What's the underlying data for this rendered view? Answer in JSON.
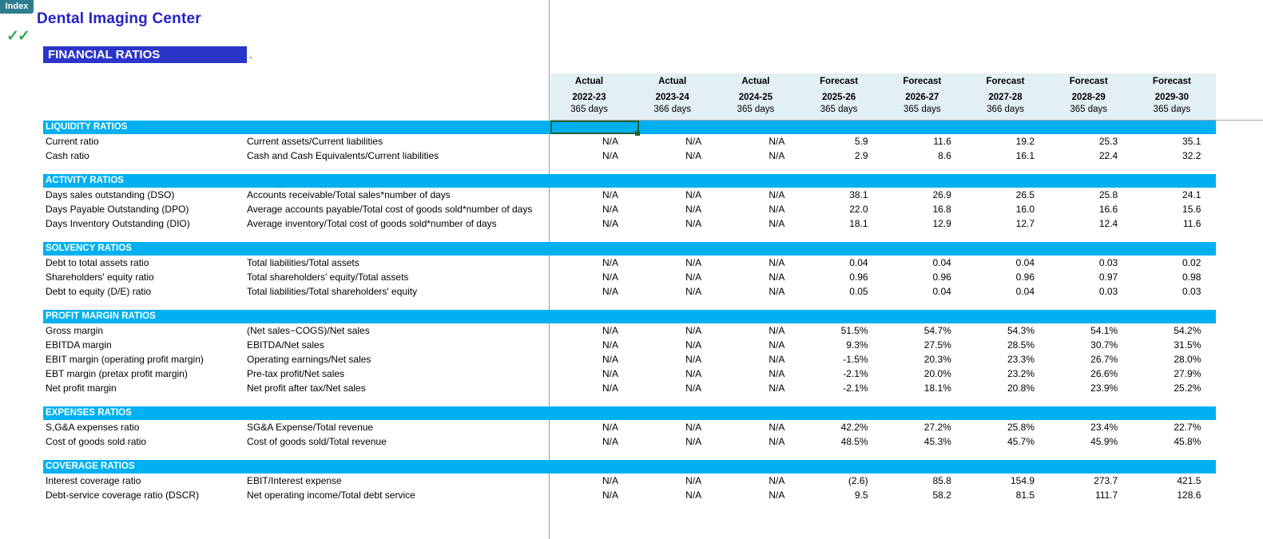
{
  "chrome": {
    "index_tab_label": "Index",
    "checkmarks": "✓✓"
  },
  "titles": {
    "company": "Dental Imaging Center",
    "banner": "FINANCIAL RATIOS",
    "banner_dot": "."
  },
  "columns": [
    {
      "type": "Actual",
      "year": "2022-23",
      "days": "365 days"
    },
    {
      "type": "Actual",
      "year": "2023-24",
      "days": "366 days"
    },
    {
      "type": "Actual",
      "year": "2024-25",
      "days": "365 days"
    },
    {
      "type": "Forecast",
      "year": "2025-26",
      "days": "365 days"
    },
    {
      "type": "Forecast",
      "year": "2026-27",
      "days": "365 days"
    },
    {
      "type": "Forecast",
      "year": "2027-28",
      "days": "366 days"
    },
    {
      "type": "Forecast",
      "year": "2028-29",
      "days": "365 days"
    },
    {
      "type": "Forecast",
      "year": "2029-30",
      "days": "365 days"
    }
  ],
  "sections": [
    {
      "title": "LIQUIDITY RATIOS",
      "rows": [
        {
          "name": "Current ratio",
          "formula": "Current assets/Current liabilities",
          "values": [
            "N/A",
            "N/A",
            "N/A",
            "5.9",
            "11.6",
            "19.2",
            "25.3",
            "35.1"
          ]
        },
        {
          "name": "Cash ratio",
          "formula": "Cash and Cash Equivalents/Current liabilities",
          "values": [
            "N/A",
            "N/A",
            "N/A",
            "2.9",
            "8.6",
            "16.1",
            "22.4",
            "32.2"
          ]
        }
      ]
    },
    {
      "title": "ACTIVITY RATIOS",
      "rows": [
        {
          "name": "Days sales outstanding (DSO)",
          "formula": "Accounts receivable/Total sales*number of days",
          "values": [
            "N/A",
            "N/A",
            "N/A",
            "38.1",
            "26.9",
            "26.5",
            "25.8",
            "24.1"
          ]
        },
        {
          "name": "Days Payable Outstanding (DPO)",
          "formula": "Average accounts payable/Total cost of goods sold*number of days",
          "values": [
            "N/A",
            "N/A",
            "N/A",
            "22.0",
            "16.8",
            "16.0",
            "16.6",
            "15.6"
          ]
        },
        {
          "name": "Days Inventory Outstanding (DIO)",
          "formula": "Average inventory/Total cost of goods sold*number of days",
          "values": [
            "N/A",
            "N/A",
            "N/A",
            "18.1",
            "12.9",
            "12.7",
            "12.4",
            "11.6"
          ]
        }
      ]
    },
    {
      "title": "SOLVENCY RATIOS",
      "rows": [
        {
          "name": "Debt to total assets ratio",
          "formula": "Total liabilities/Total assets",
          "values": [
            "N/A",
            "N/A",
            "N/A",
            "0.04",
            "0.04",
            "0.04",
            "0.03",
            "0.02"
          ]
        },
        {
          "name": "Shareholders' equity ratio",
          "formula": "Total shareholders' equity/Total assets",
          "values": [
            "N/A",
            "N/A",
            "N/A",
            "0.96",
            "0.96",
            "0.96",
            "0.97",
            "0.98"
          ]
        },
        {
          "name": "Debt to equity (D/E) ratio",
          "formula": "Total liabilities/Total shareholders' equity",
          "values": [
            "N/A",
            "N/A",
            "N/A",
            "0.05",
            "0.04",
            "0.04",
            "0.03",
            "0.03"
          ]
        }
      ]
    },
    {
      "title": "PROFIT MARGIN RATIOS",
      "rows": [
        {
          "name": "Gross margin",
          "formula": "(Net sales−COGS)/Net sales",
          "values": [
            "N/A",
            "N/A",
            "N/A",
            "51.5%",
            "54.7%",
            "54.3%",
            "54.1%",
            "54.2%"
          ]
        },
        {
          "name": "EBITDA margin",
          "formula": "EBITDA/Net sales",
          "values": [
            "N/A",
            "N/A",
            "N/A",
            "9.3%",
            "27.5%",
            "28.5%",
            "30.7%",
            "31.5%"
          ]
        },
        {
          "name": "EBIT margin (operating profit margin)",
          "formula": "Operating earnings/Net sales",
          "values": [
            "N/A",
            "N/A",
            "N/A",
            "-1.5%",
            "20.3%",
            "23.3%",
            "26.7%",
            "28.0%"
          ]
        },
        {
          "name": "EBT margin (pretax profit margin)",
          "formula": "Pre-tax profit/Net sales",
          "values": [
            "N/A",
            "N/A",
            "N/A",
            "-2.1%",
            "20.0%",
            "23.2%",
            "26.6%",
            "27.9%"
          ]
        },
        {
          "name": "Net profit margin",
          "formula": "Net profit after tax/Net sales",
          "values": [
            "N/A",
            "N/A",
            "N/A",
            "-2.1%",
            "18.1%",
            "20.8%",
            "23.9%",
            "25.2%"
          ]
        }
      ]
    },
    {
      "title": "EXPENSES RATIOS",
      "rows": [
        {
          "name": "S,G&A expenses ratio",
          "formula": "SG&A Expense/Total revenue",
          "values": [
            "N/A",
            "N/A",
            "N/A",
            "42.2%",
            "27.2%",
            "25.8%",
            "23.4%",
            "22.7%"
          ]
        },
        {
          "name": "Cost of goods sold ratio",
          "formula": "Cost of goods sold/Total revenue",
          "values": [
            "N/A",
            "N/A",
            "N/A",
            "48.5%",
            "45.3%",
            "45.7%",
            "45.9%",
            "45.8%"
          ]
        }
      ]
    },
    {
      "title": "COVERAGE RATIOS",
      "rows": [
        {
          "name": "Interest coverage ratio",
          "formula": "EBIT/Interest expense",
          "values": [
            "N/A",
            "N/A",
            "N/A",
            "(2.6)",
            "85.8",
            "154.9",
            "273.7",
            "421.5"
          ]
        },
        {
          "name": "Debt-service coverage ratio (DSCR)",
          "formula": "Net operating income/Total debt service",
          "values": [
            "N/A",
            "N/A",
            "N/A",
            "9.5",
            "58.2",
            "81.5",
            "111.7",
            "128.6"
          ]
        }
      ]
    }
  ],
  "colors": {
    "section_bar": "#00b0f0",
    "header_band": "#e2eff3",
    "title_blue": "#2323c8",
    "banner_blue": "#2b35c8",
    "index_tab": "#2e7d8e",
    "checkmark_green": "#2fa84f",
    "selection_green": "#1f6133"
  }
}
